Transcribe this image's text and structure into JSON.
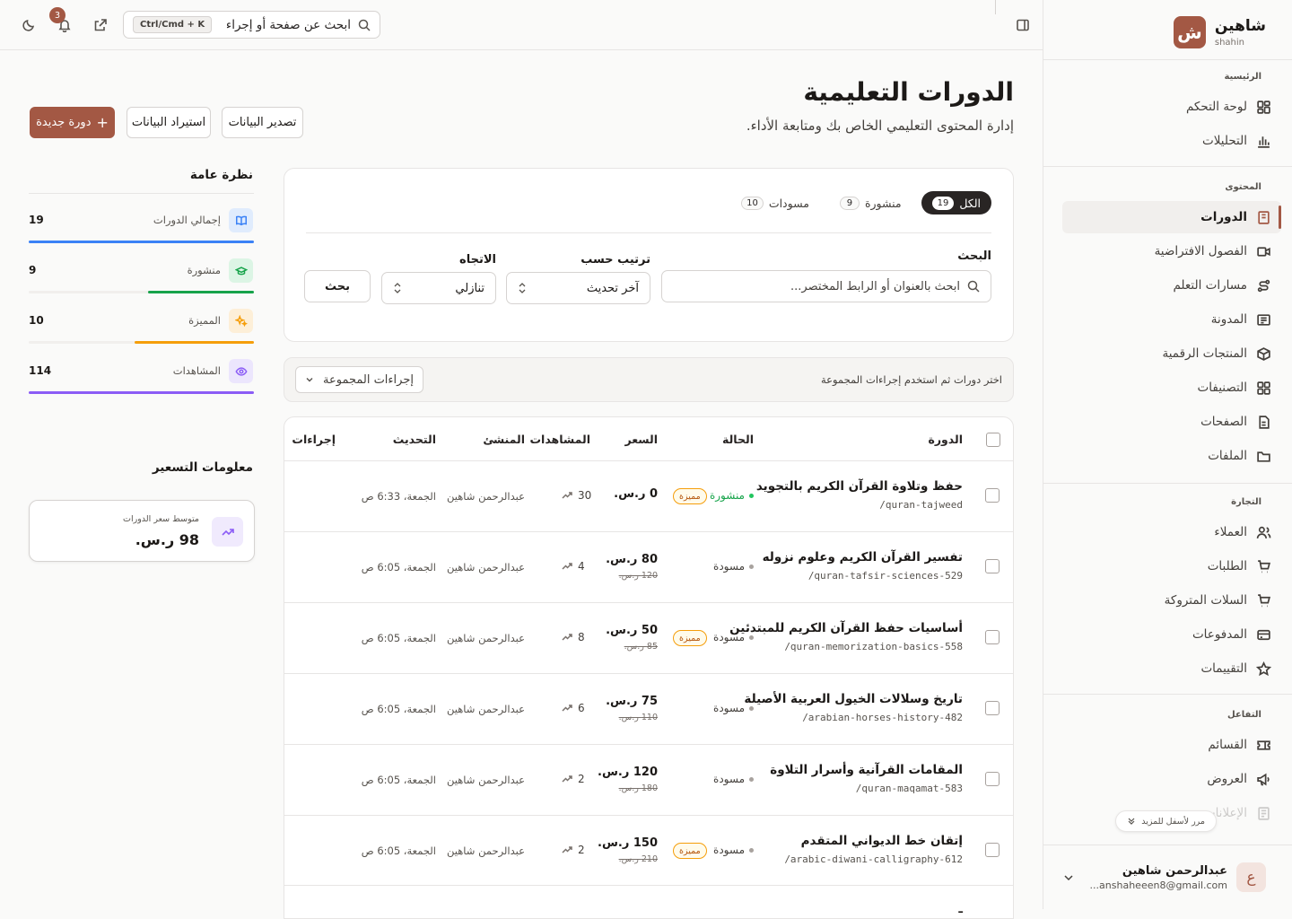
{
  "brand": {
    "logo_letter": "ش",
    "name": "شاهين",
    "sub": "shahin"
  },
  "sidebar": {
    "sections": [
      {
        "title": "الرئيسية",
        "items": [
          {
            "label": "لوحة التحكم",
            "icon": "dashboard-icon"
          },
          {
            "label": "التحليلات",
            "icon": "chart-icon"
          }
        ]
      },
      {
        "title": "المحتوى",
        "items": [
          {
            "label": "الدورات",
            "icon": "book-icon",
            "active": true
          },
          {
            "label": "الفصول الافتراضية",
            "icon": "video-icon"
          },
          {
            "label": "مسارات التعلم",
            "icon": "route-icon"
          },
          {
            "label": "المدونة",
            "icon": "blog-icon"
          },
          {
            "label": "المنتجات الرقمية",
            "icon": "box-icon"
          },
          {
            "label": "التصنيفات",
            "icon": "grid-icon"
          },
          {
            "label": "الصفحات",
            "icon": "page-icon"
          },
          {
            "label": "الملفات",
            "icon": "folder-icon"
          }
        ]
      },
      {
        "title": "التجارة",
        "items": [
          {
            "label": "العملاء",
            "icon": "users-icon"
          },
          {
            "label": "الطلبات",
            "icon": "cart-icon"
          },
          {
            "label": "السلات المتروكة",
            "icon": "cart-icon"
          },
          {
            "label": "المدفوعات",
            "icon": "card-icon"
          },
          {
            "label": "التقييمات",
            "icon": "star-icon"
          }
        ]
      },
      {
        "title": "التفاعل",
        "items": [
          {
            "label": "القسائم",
            "icon": "ticket-icon"
          },
          {
            "label": "العروض",
            "icon": "megaphone-icon"
          },
          {
            "label": "الإعلانات",
            "icon": "news-icon"
          }
        ]
      }
    ],
    "scroll_hint": "مرر لأسفل للمزيد",
    "user": {
      "initial": "ع",
      "name": "عبدالرحمن شاهين",
      "email": "anshaheeen8@gmail.com..."
    }
  },
  "topbar": {
    "search_placeholder": "ابحث عن صفحة أو إجراء",
    "shortcut": "Ctrl/Cmd + K",
    "notifications": "3"
  },
  "page": {
    "title": "الدورات التعليمية",
    "subtitle": "إدارة المحتوى التعليمي الخاص بك ومتابعة الأداء.",
    "export_label": "تصدير البيانات",
    "import_label": "استيراد البيانات",
    "new_label": "دورة جديدة"
  },
  "filters": {
    "tabs": [
      {
        "label": "الكل",
        "count": "19",
        "active": true
      },
      {
        "label": "منشورة",
        "count": "9"
      },
      {
        "label": "مسودات",
        "count": "10"
      }
    ],
    "search_label": "البحث",
    "search_placeholder": "ابحث بالعنوان أو الرابط المختصر...",
    "sort_label": "ترتيب حسب",
    "sort_value": "آخر تحديث",
    "dir_label": "الاتجاه",
    "dir_value": "تنازلي",
    "search_button": "بحث"
  },
  "bulk": {
    "hint": "اختر دورات ثم استخدم إجراءات المجموعة",
    "button": "إجراءات المجموعة"
  },
  "table": {
    "headers": {
      "course": "الدورة",
      "status": "الحالة",
      "price": "السعر",
      "views": "المشاهدات",
      "author": "المنشئ",
      "updated": "التحديث",
      "actions": "إجراءات"
    },
    "featured_label": "مميزة",
    "rows": [
      {
        "title": "حفظ وتلاوة القرآن الكريم بالتجويد",
        "slug": "quran-tajweed/",
        "status": "منشورة",
        "published": true,
        "featured": true,
        "price": "0 ر.س.",
        "old_price": "",
        "views": "30",
        "author": "عبدالرحمن شاهين",
        "updated": "الجمعة، 6:33 ص"
      },
      {
        "title": "تفسير القرآن الكريم وعلوم نزوله",
        "slug": "quran-tafsir-sciences-529/",
        "status": "مسودة",
        "published": false,
        "featured": false,
        "price": "80 ر.س.",
        "old_price": "120 ر.س.",
        "views": "4",
        "author": "عبدالرحمن شاهين",
        "updated": "الجمعة، 6:05 ص"
      },
      {
        "title": "أساسيات حفظ القرآن الكريم للمبتدئين",
        "slug": "quran-memorization-basics-558/",
        "status": "مسودة",
        "published": false,
        "featured": true,
        "price": "50 ر.س.",
        "old_price": "85 ر.س.",
        "views": "8",
        "author": "عبدالرحمن شاهين",
        "updated": "الجمعة، 6:05 ص"
      },
      {
        "title": "تاريخ وسلالات الخيول العربية الأصيلة",
        "slug": "arabian-horses-history-482/",
        "status": "مسودة",
        "published": false,
        "featured": false,
        "price": "75 ر.س.",
        "old_price": "110 ر.س.",
        "views": "6",
        "author": "عبدالرحمن شاهين",
        "updated": "الجمعة، 6:05 ص"
      },
      {
        "title": "المقامات القرآنية وأسرار التلاوة",
        "slug": "quran-maqamat-583/",
        "status": "مسودة",
        "published": false,
        "featured": false,
        "price": "120 ر.س.",
        "old_price": "180 ر.س.",
        "views": "2",
        "author": "عبدالرحمن شاهين",
        "updated": "الجمعة، 6:05 ص"
      },
      {
        "title": "إتقان خط الديواني المتقدم",
        "slug": "arabic-diwani-calligraphy-612/",
        "status": "مسودة",
        "published": false,
        "featured": true,
        "price": "150 ر.س.",
        "old_price": "210 ر.س.",
        "views": "2",
        "author": "عبدالرحمن شاهين",
        "updated": "الجمعة، 6:05 ص"
      }
    ]
  },
  "overview": {
    "title": "نظرة عامة",
    "stats": [
      {
        "label": "إجمالي الدورات",
        "value": "19",
        "fraction": 1.0,
        "color": "#3b82f6",
        "bg": "#e0ecfd",
        "icon": "book-open-icon"
      },
      {
        "label": "منشورة",
        "value": "9",
        "fraction": 0.47,
        "color": "#16a34a",
        "bg": "#dcf5e5",
        "icon": "graduation-cap-icon"
      },
      {
        "label": "المميزة",
        "value": "10",
        "fraction": 0.53,
        "color": "#f59e0b",
        "bg": "#fdefd8",
        "icon": "sparkles-icon"
      },
      {
        "label": "المشاهدات",
        "value": "114",
        "fraction": 1.0,
        "color": "#8b5cf6",
        "bg": "#ece6fd",
        "icon": "eye-icon"
      }
    ]
  },
  "pricing": {
    "title": "معلومات التسعير",
    "avg_label": "متوسط سعر الدورات",
    "avg_value": "98 ر.س."
  }
}
